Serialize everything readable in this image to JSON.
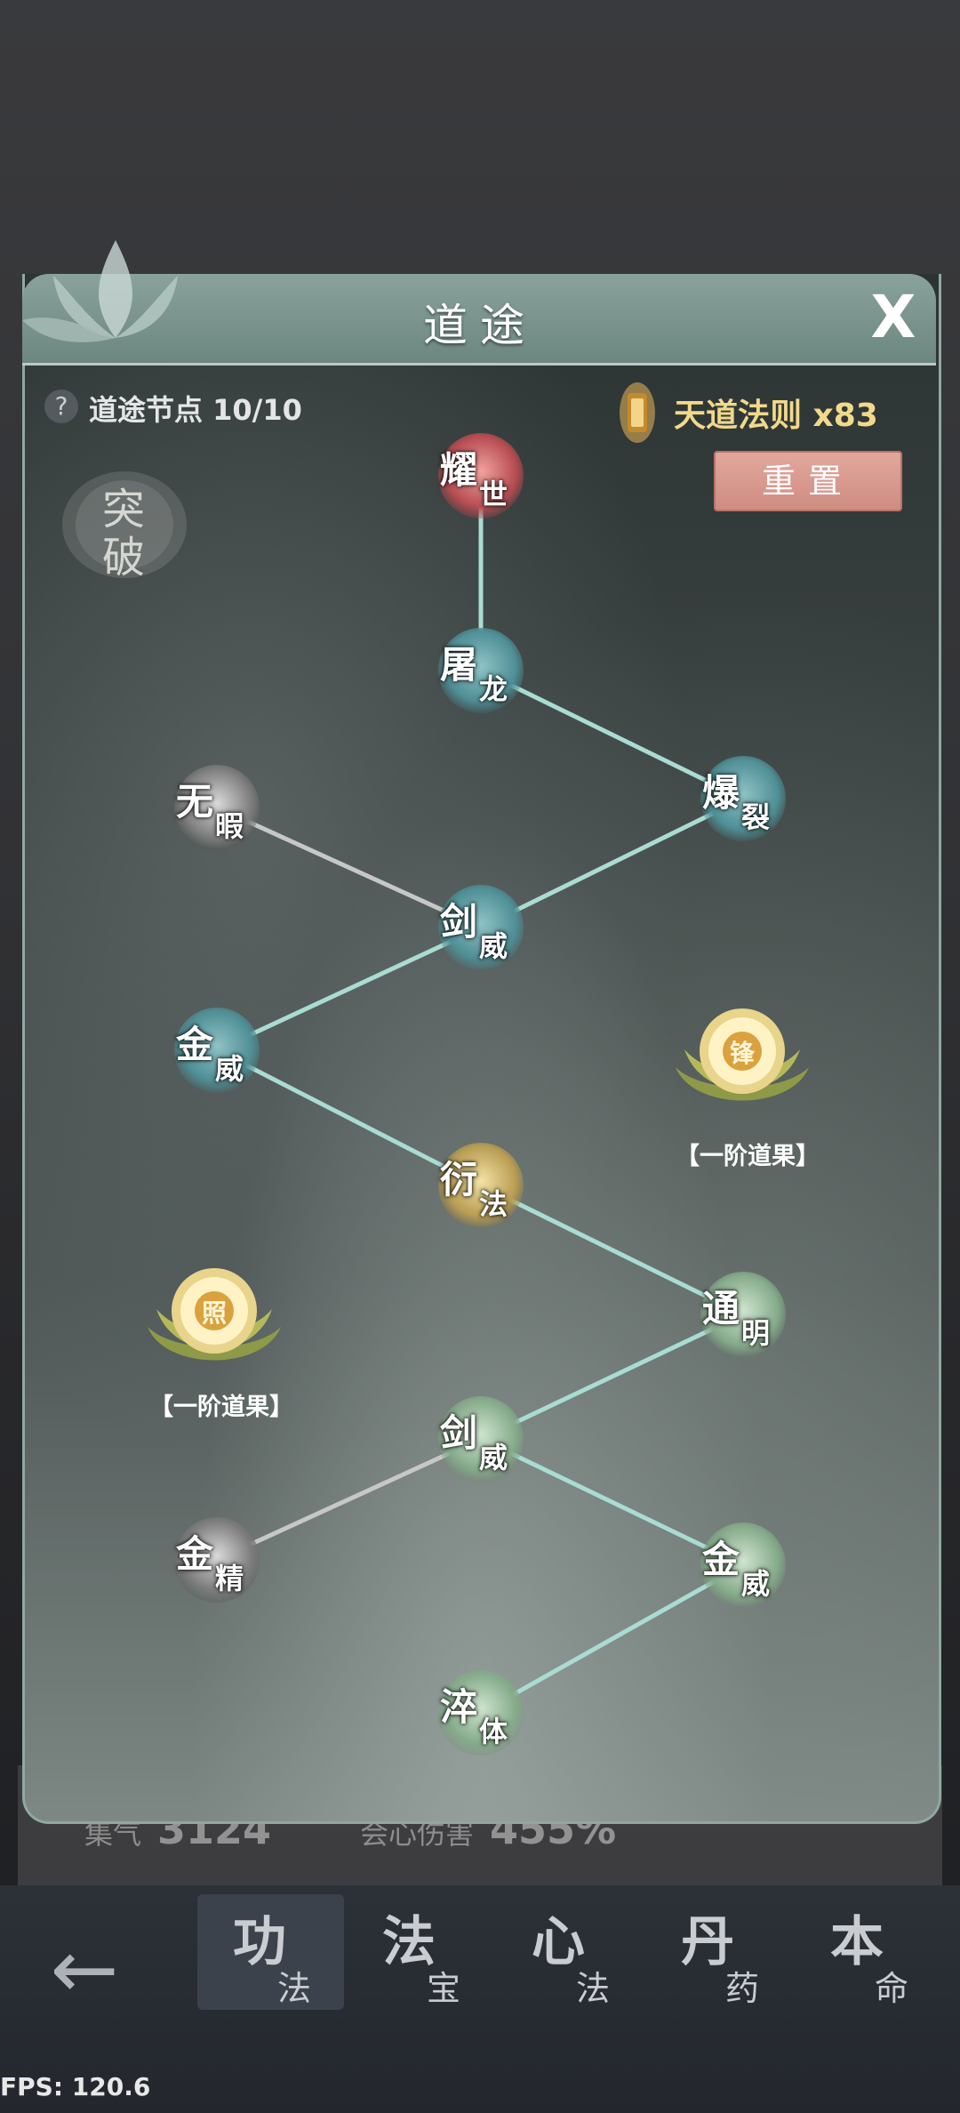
{
  "window": {
    "title": "道途",
    "close_label": "X"
  },
  "status": {
    "nodes_label": "道途节点 10/10",
    "rules_label": "天道法则 x83",
    "help_label": "?"
  },
  "actions": {
    "reset_label": "重置"
  },
  "breakthrough": {
    "char1": "突",
    "char2": "破"
  },
  "nodes": [
    {
      "id": "yaoshi",
      "c1": "耀",
      "c2": "世",
      "state": "red"
    },
    {
      "id": "tulong",
      "c1": "屠",
      "c2": "龙",
      "state": "teal"
    },
    {
      "id": "baolie",
      "c1": "爆",
      "c2": "裂",
      "state": "teal"
    },
    {
      "id": "wuxia",
      "c1": "无",
      "c2": "暇",
      "state": "grey"
    },
    {
      "id": "jianwei1",
      "c1": "剑",
      "c2": "威",
      "state": "teal"
    },
    {
      "id": "jinwei1",
      "c1": "金",
      "c2": "威",
      "state": "teal"
    },
    {
      "id": "yanfa",
      "c1": "衍",
      "c2": "法",
      "state": "gold"
    },
    {
      "id": "tongming",
      "c1": "通",
      "c2": "明",
      "state": "green"
    },
    {
      "id": "jianwei2",
      "c1": "剑",
      "c2": "威",
      "state": "green"
    },
    {
      "id": "jinjing",
      "c1": "金",
      "c2": "精",
      "state": "grey"
    },
    {
      "id": "jinwei2",
      "c1": "金",
      "c2": "威",
      "state": "green"
    },
    {
      "id": "cuiti",
      "c1": "淬",
      "c2": "体",
      "state": "green"
    }
  ],
  "fruits": [
    {
      "id": "feng",
      "glyph": "锋",
      "label": "【一阶道果】"
    },
    {
      "id": "zhao",
      "glyph": "照",
      "label": "【一阶道果】"
    }
  ],
  "background": {
    "stat1_label": "集气",
    "stat1_value": "3124",
    "stat2_label": "会心伤害",
    "stat2_value": "455%"
  },
  "tabs": [
    {
      "big": "功",
      "small": "法",
      "active": true
    },
    {
      "big": "法",
      "small": "宝",
      "active": false
    },
    {
      "big": "心",
      "small": "法",
      "active": false
    },
    {
      "big": "丹",
      "small": "药",
      "active": false
    },
    {
      "big": "本",
      "small": "命",
      "active": false
    }
  ],
  "fps_label": "FPS: 120.6",
  "colors": {
    "teal_line": "#a9dcd2",
    "grey_line": "#c7c7c7",
    "rule_text": "#f2d98a",
    "reset_button": "#d99a8f"
  },
  "icons": {
    "back": "back-arrow-icon",
    "close": "close-icon",
    "help": "help-icon"
  }
}
